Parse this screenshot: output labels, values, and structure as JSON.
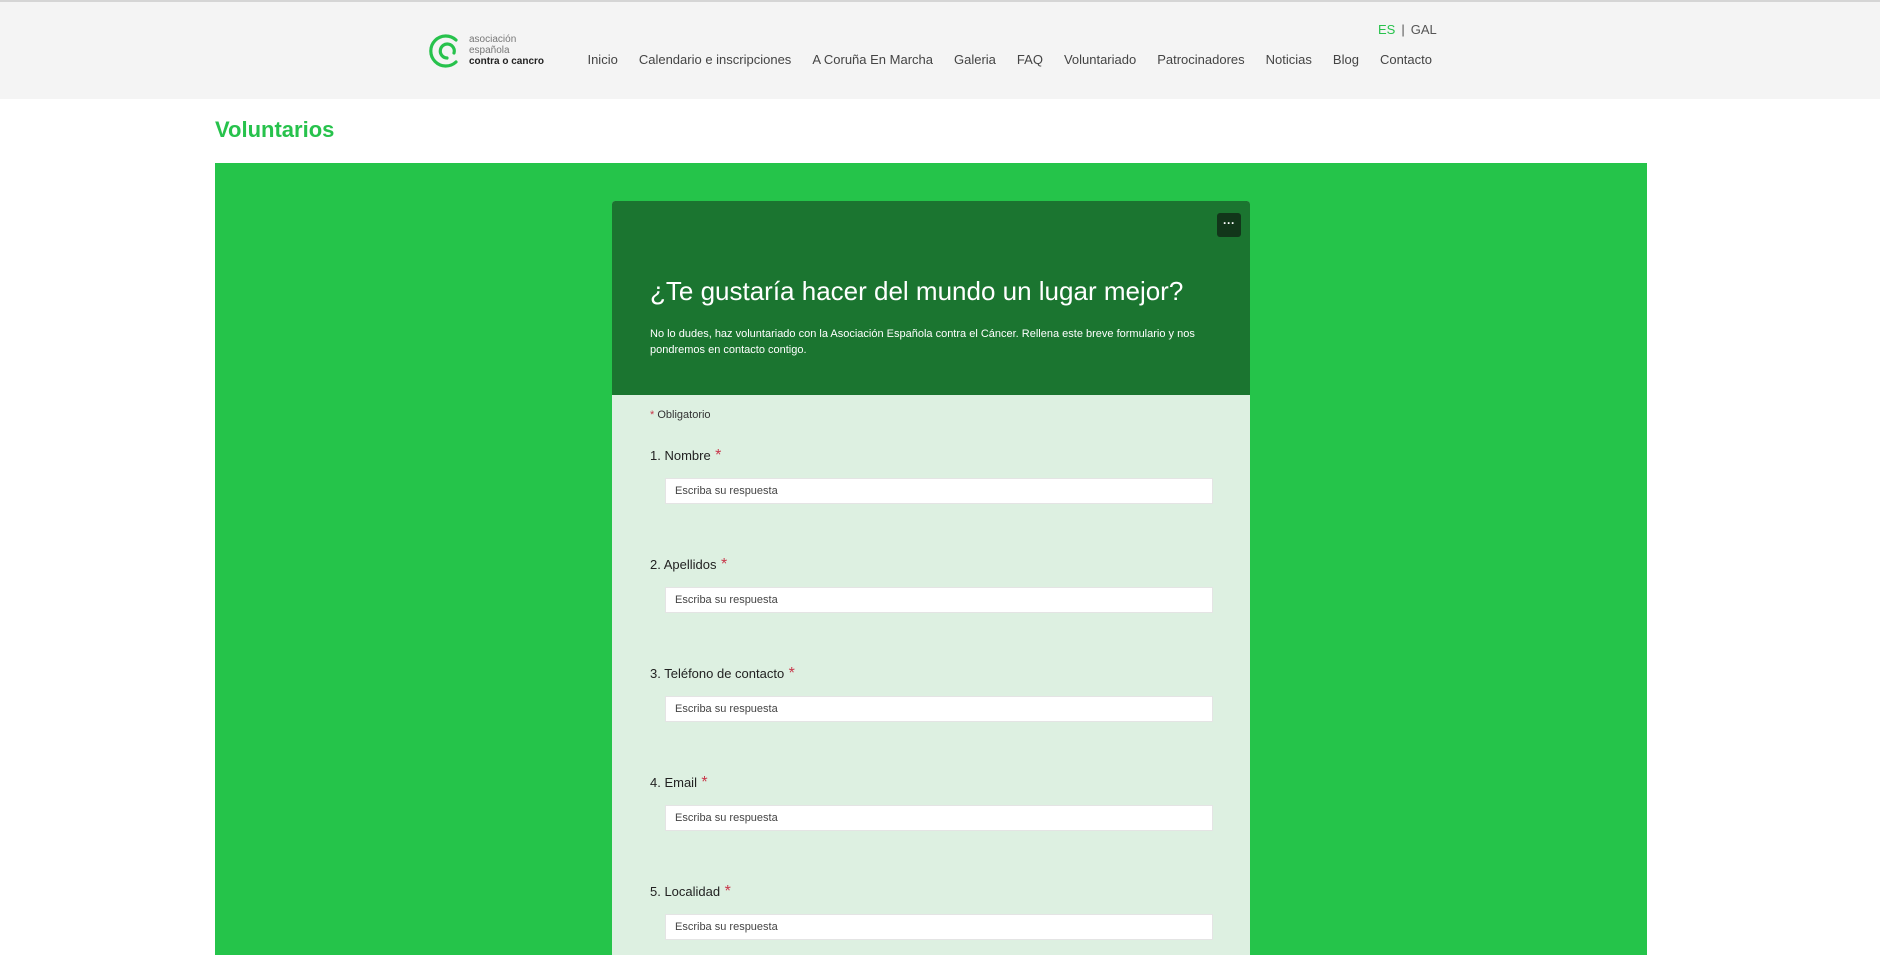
{
  "logo": {
    "line1": "asociación",
    "line2": "española",
    "line3": "contra o cancro"
  },
  "lang": {
    "es": "ES",
    "separator": "|",
    "gal": "GAL"
  },
  "nav": [
    "Inicio",
    "Calendario e inscripciones",
    "A Coruña En Marcha",
    "Galeria",
    "FAQ",
    "Voluntariado",
    "Patrocinadores",
    "Noticias",
    "Blog",
    "Contacto"
  ],
  "page": {
    "title": "Voluntarios"
  },
  "form": {
    "more_label": "···",
    "title": "¿Te gustaría hacer del mundo un lugar mejor?",
    "description": "No lo dudes, haz voluntariado con la Asociación Española contra el Cáncer. Rellena este breve formulario y nos pondremos en contacto contigo.",
    "required_star": "*",
    "required_note": "Obligatorio",
    "questions": [
      {
        "label": "1. Nombre",
        "star": "*",
        "placeholder": "Escriba su respuesta"
      },
      {
        "label": "2. Apellidos",
        "star": "*",
        "placeholder": "Escriba su respuesta"
      },
      {
        "label": "3. Teléfono de contacto",
        "star": "*",
        "placeholder": "Escriba su respuesta"
      },
      {
        "label": "4. Email",
        "star": "*",
        "placeholder": "Escriba su respuesta"
      },
      {
        "label": "5. Localidad",
        "star": "*",
        "placeholder": "Escriba su respuesta"
      }
    ]
  },
  "colors": {
    "brand_green": "#27c24c",
    "panel_green": "#25c44a",
    "form_header": "#1b7530",
    "form_body": "#ddf0e1",
    "required": "#c8374a"
  }
}
